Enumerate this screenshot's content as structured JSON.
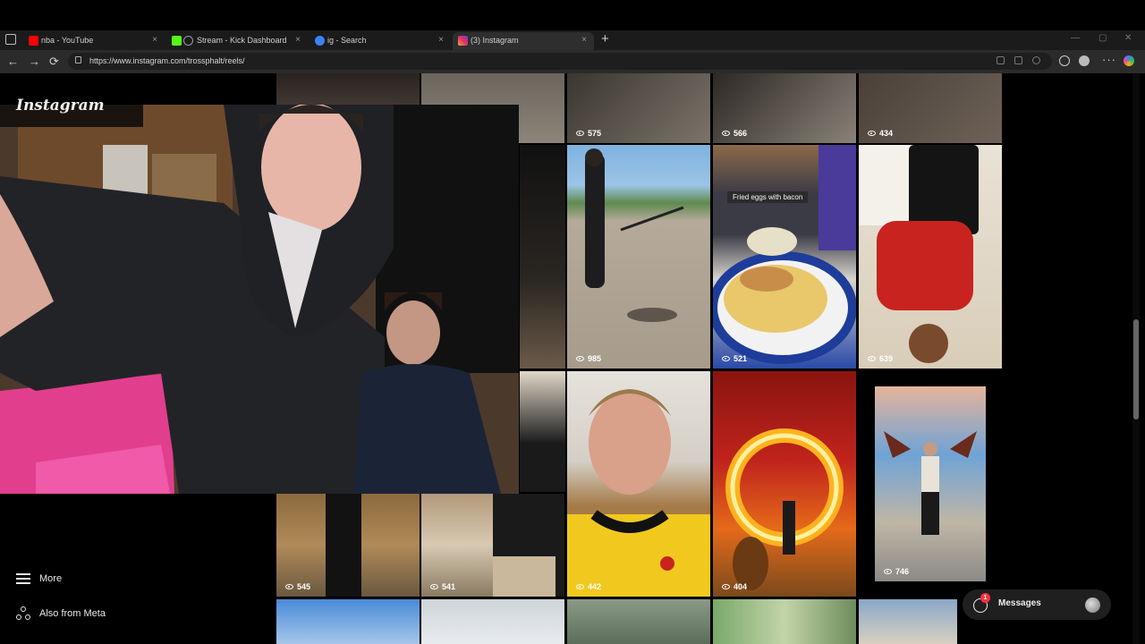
{
  "browser": {
    "tabs": [
      {
        "title": "nba - YouTube",
        "favicon_color": "#ff0000",
        "active": false
      },
      {
        "title": "Stream - Kick Dashboard",
        "favicon_color": "#53fc18",
        "active": false
      },
      {
        "title": "ig - Search",
        "favicon_color": "#3b82f6",
        "active": false
      },
      {
        "title": "(3) Instagram",
        "favicon_color": "#e1306c",
        "active": true
      }
    ],
    "close_glyph": "×",
    "newtab_glyph": "+",
    "url": "https://www.instagram.com/trossphalt/reels/",
    "nav": {
      "back": "←",
      "forward": "→",
      "reload": "⟳"
    }
  },
  "sidebar": {
    "logo": "Instagram",
    "more_label": "More",
    "meta_label": "Also from Meta"
  },
  "reels": [
    {
      "id": "r1",
      "views": "575"
    },
    {
      "id": "r2",
      "views": "566"
    },
    {
      "id": "r3",
      "views": "434"
    },
    {
      "id": "r4",
      "views": "985"
    },
    {
      "id": "r5",
      "views": "521"
    },
    {
      "id": "r6",
      "views": "639"
    },
    {
      "id": "r7",
      "views": "545"
    },
    {
      "id": "r8",
      "views": "541"
    },
    {
      "id": "r9",
      "views": "442"
    },
    {
      "id": "r10",
      "views": "404"
    },
    {
      "id": "r11",
      "views": "746"
    }
  ],
  "food_caption": "Fried eggs with bacon",
  "messages": {
    "label": "Messages",
    "badge": "1"
  },
  "icons": [
    "tab-actions-icon",
    "back-icon",
    "forward-icon",
    "reload-icon",
    "lock-icon",
    "eye-icon",
    "hamburger-icon",
    "meta-icon",
    "messenger-icon"
  ]
}
